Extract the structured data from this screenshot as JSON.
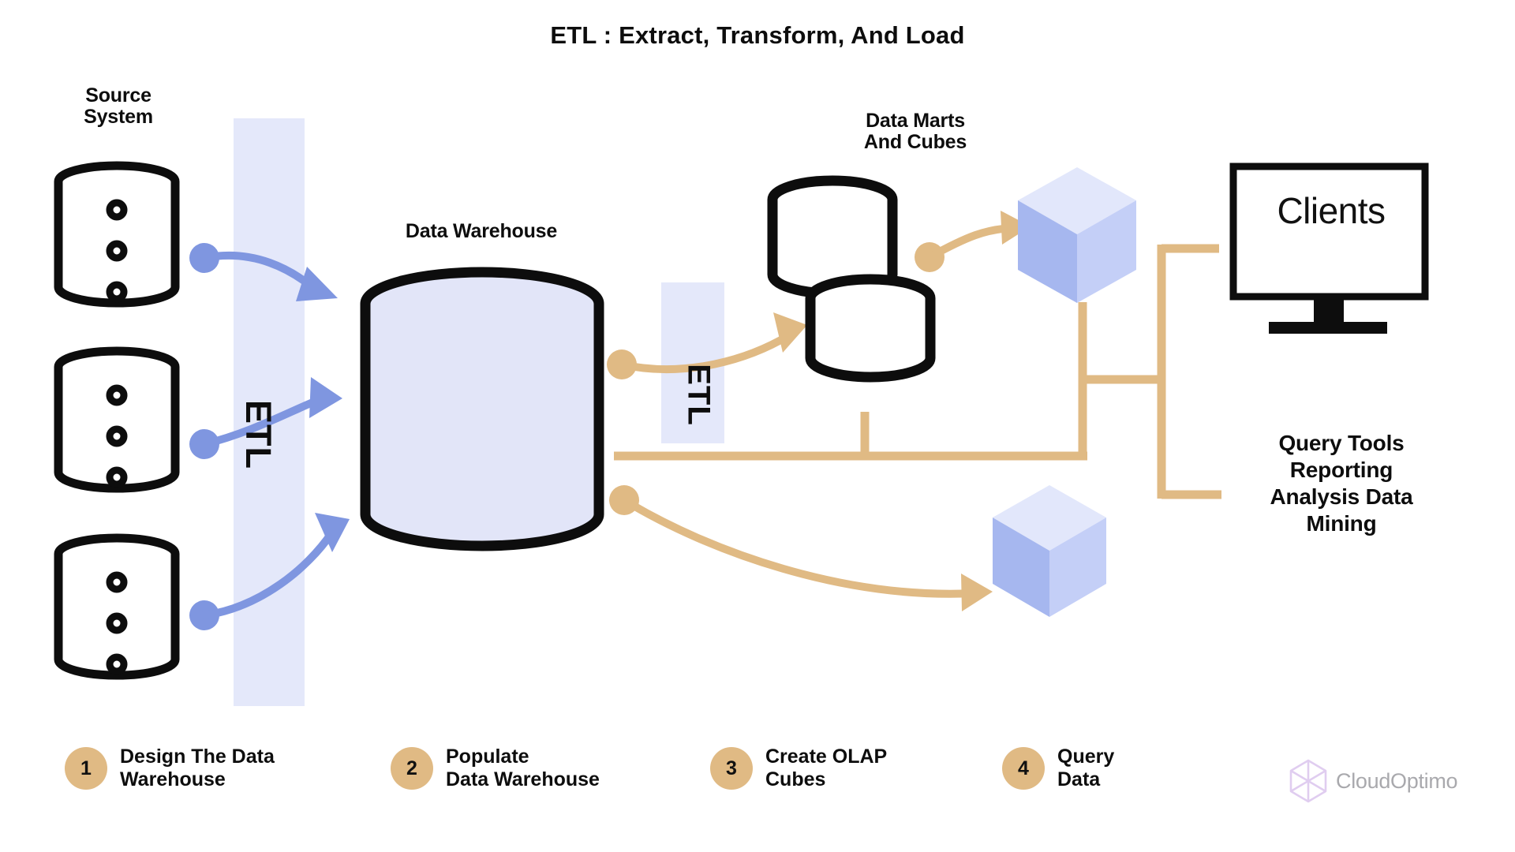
{
  "title": "ETL : Extract, Transform, And Load",
  "labels": {
    "source_system": "Source\nSystem",
    "data_warehouse": "Data Warehouse",
    "data_marts": "Data Marts\nAnd Cubes",
    "clients": "Clients",
    "query_tools": "Query Tools\nReporting\nAnalysis Data\nMining",
    "etl_left": "ETL",
    "etl_right": "ETL"
  },
  "steps": [
    {
      "number": "1",
      "label": "Design The Data\nWarehouse"
    },
    {
      "number": "2",
      "label": "Populate\nData Warehouse"
    },
    {
      "number": "3",
      "label": "Create OLAP\nCubes"
    },
    {
      "number": "4",
      "label": "Query\nData"
    }
  ],
  "logo": {
    "text": "CloudOptimo",
    "icon": "hexagon-cube-icon"
  },
  "colors": {
    "blue_accent": "#7f96e0",
    "blue_band": "#e4e8fa",
    "cylinder_fill": "#e2e5f8",
    "tan_accent": "#e0ba84",
    "cube_top": "#e2e7fb",
    "cube_left": "#a6b7ef",
    "cube_right": "#c4cff7",
    "outline": "#0d0d0d",
    "logo_text": "#a9a9ad",
    "logo_icon": "#e0cdf0"
  },
  "icons": {
    "source_db": "database-cylinder-icon",
    "warehouse_db": "warehouse-cylinder-icon",
    "mart_cylinder": "data-mart-cylinder-icon",
    "olap_cube": "olap-cube-icon",
    "client_monitor": "monitor-icon",
    "blue_arrow": "curved-arrow-icon",
    "tan_arrow": "curved-arrow-icon"
  }
}
